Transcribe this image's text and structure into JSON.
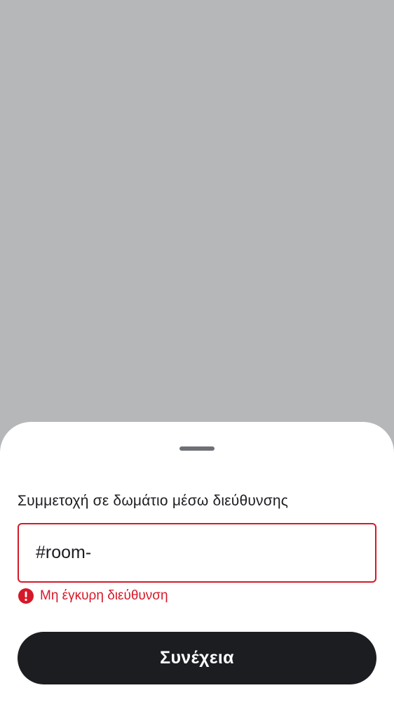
{
  "colors": {
    "scrim": "#b6b7b9",
    "sheet_background": "#ffffff",
    "primary_text": "#1b1d21",
    "error": "#d51928",
    "button_background": "#1b1d21",
    "button_text": "#ffffff",
    "handle": "#6e7075"
  },
  "sheet": {
    "title": "Συμμετοχή σε δωμάτιο μέσω διεύθυνσης",
    "address_input": {
      "value": "#room-"
    },
    "error": {
      "icon": "error-icon",
      "message": "Μη έγκυρη διεύθυνση"
    },
    "continue_button": {
      "label": "Συνέχεια"
    }
  }
}
